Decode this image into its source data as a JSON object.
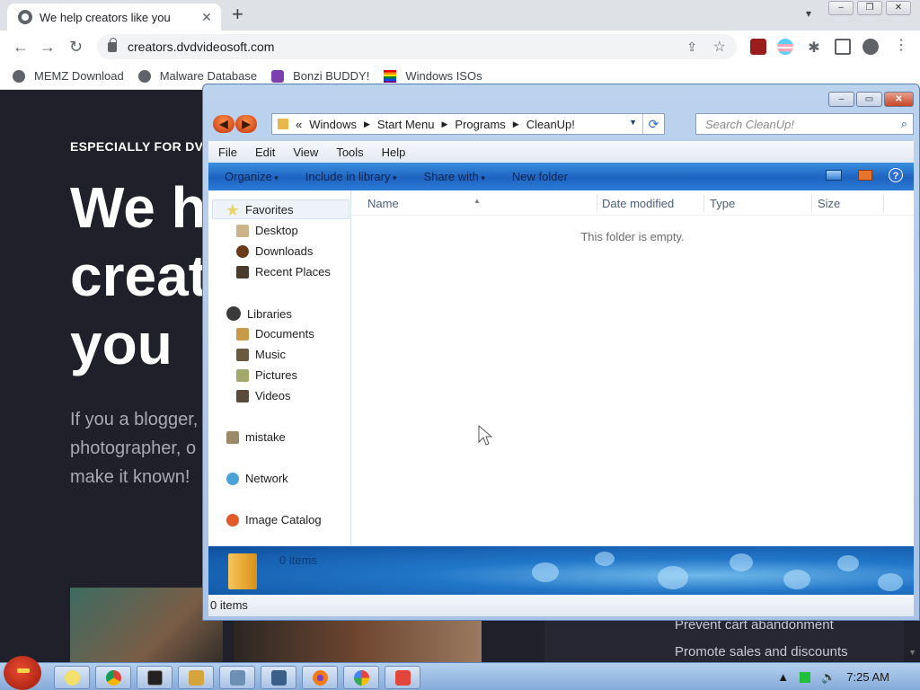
{
  "browser": {
    "tab_title": "We help creators like you",
    "tab_close": "✕",
    "new_tab": "+",
    "url": "creators.dvdvideosoft.com",
    "bookmarks": [
      {
        "label": "MEMZ Download"
      },
      {
        "label": "Malware Database"
      },
      {
        "label": "Bonzi BUDDY!"
      },
      {
        "label": "Windows ISOs"
      }
    ]
  },
  "webpage": {
    "eyebrow": "ESPECIALLY FOR DVD",
    "hero_lines": [
      "We h",
      "creat",
      "you"
    ],
    "sub_lines": [
      "If you a blogger,",
      "photographer, o",
      "make it known!"
    ],
    "side_links": [
      "Prevent cart abandonment",
      "Promote sales and discounts"
    ]
  },
  "explorer": {
    "breadcrumb_prefix": "«",
    "breadcrumb": [
      "Windows",
      "Start Menu",
      "Programs",
      "CleanUp!"
    ],
    "search_placeholder": "Search CleanUp!",
    "menu": [
      "File",
      "Edit",
      "View",
      "Tools",
      "Help"
    ],
    "commands": [
      "Organize",
      "Include in library",
      "Share with",
      "New folder"
    ],
    "nav": {
      "favorites": "Favorites",
      "favorites_items": [
        "Desktop",
        "Downloads",
        "Recent Places"
      ],
      "libraries": "Libraries",
      "libraries_items": [
        "Documents",
        "Music",
        "Pictures",
        "Videos"
      ],
      "mistake": "mistake",
      "network": "Network",
      "image_catalog": "Image Catalog"
    },
    "columns": [
      "Name",
      "Date modified",
      "Type",
      "Size"
    ],
    "empty_message": "This folder is empty.",
    "details_count": "0 items",
    "status": "0 items"
  },
  "taskbar": {
    "time": "7:25 AM"
  },
  "icons": {
    "tab_favicon": "globe-icon",
    "lock": "lock-icon",
    "help": "?"
  },
  "colors": {
    "page_bg": "#1f2029",
    "explorer_cmdbar": "#1e63c0",
    "accent_orange": "#c2340b"
  }
}
